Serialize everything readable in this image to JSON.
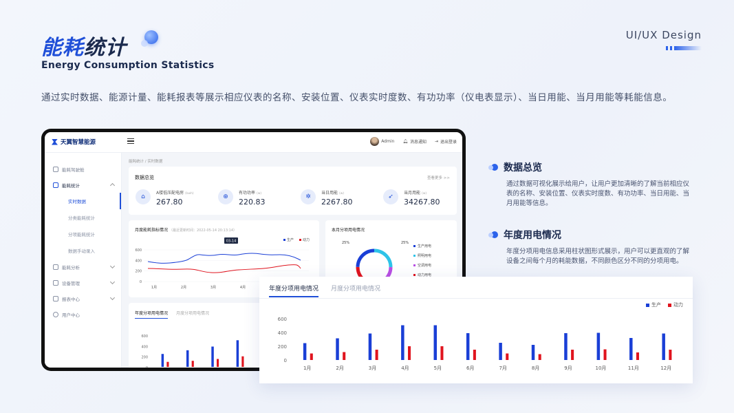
{
  "header": {
    "title_cn_blue": "能耗",
    "title_cn_rest": "统计",
    "title_en": "Energy Consumption Statistics",
    "brand_tag": "UI/UX Design",
    "intro": "通过实时数据、能源计量、能耗报表等展示相应仪表的名称、安装位置、仪表实时度数、有功功率（仪电表显示）、当日用能、当月用能等耗能信息。"
  },
  "app": {
    "logo": "天翼智慧能源",
    "user": "Admin",
    "notify": "消息通知",
    "logout": "退出登录",
    "breadcrumb": "能耗统计 / 实时数据",
    "sidebar": [
      {
        "label": "能耗驾驶舱",
        "icon": "home-icon"
      },
      {
        "label": "能耗统计",
        "icon": "stats-icon",
        "open": true
      },
      {
        "label": "能耗分析",
        "icon": "analysis-icon"
      },
      {
        "label": "设备管理",
        "icon": "device-icon"
      },
      {
        "label": "报表中心",
        "icon": "report-icon"
      },
      {
        "label": "用户中心",
        "icon": "user-icon"
      }
    ],
    "submenu": [
      "实时数据",
      "分类能耗统计",
      "分项能耗统计",
      "数据手动录入"
    ],
    "overview": {
      "title": "数据总览",
      "more": "查看更多 >>",
      "items": [
        {
          "label": "A楼低压配电房",
          "unit": "(kwh)",
          "value": "267.80",
          "icon": "building-icon"
        },
        {
          "label": "有功功率",
          "unit": "(w)",
          "value": "220.83",
          "icon": "power-icon"
        },
        {
          "label": "当日用能",
          "unit": "(w)",
          "value": "2267.80",
          "icon": "daily-icon"
        },
        {
          "label": "当月用能",
          "unit": "(w)",
          "value": "34267.80",
          "icon": "rocket-icon"
        }
      ]
    },
    "line_card": {
      "title": "月度能耗指标情况",
      "sub": "（最近更新时间：2022-05-14 20:13:14）",
      "tooltip": "03-14"
    },
    "pie_card": {
      "title": "本月分项用电情况",
      "pct_left": "25%",
      "pct_right": "25%",
      "legend": [
        "生产用电",
        "照明用电",
        "空调用电",
        "动力用电"
      ]
    },
    "bar_tabs": [
      "年度分项用电情况",
      "月度分项用电情况"
    ]
  },
  "features": [
    {
      "title": "数据总览",
      "text": "通过数据可视化展示给用户，让用户更加清晰的了解当前相应仪表的名称、安装位置、仪表实时度数、有功功率、当日用能、当月用能等信息。"
    },
    {
      "title": "年度用电情况",
      "text": "年度分项用电信息采用柱状图形式展示，用户可以更直观的了解设备之间每个月的耗能数据，不同颜色区分不同的分项用电。"
    }
  ],
  "popup": {
    "tabs": [
      "年度分项用电情况",
      "月度分项用电情况"
    ]
  },
  "colors": {
    "accent": "#1f4fd8",
    "production": "#1a3fd6",
    "power": "#e0141e",
    "cyan": "#2ec3e8",
    "purple": "#b94fe3"
  },
  "chart_data": [
    {
      "type": "bar",
      "title": "年度分项用电情况",
      "categories": [
        "1月",
        "2月",
        "3月",
        "4月",
        "5月",
        "6月",
        "7月",
        "8月",
        "9月",
        "10月",
        "11月",
        "12月"
      ],
      "ylim": [
        0,
        600
      ],
      "yticks": [
        0,
        200,
        400,
        600
      ],
      "series": [
        {
          "name": "生产",
          "values": [
            245,
            315,
            385,
            505,
            505,
            390,
            250,
            220,
            390,
            395,
            320,
            385
          ],
          "color": "#1a3fd6"
        },
        {
          "name": "动力",
          "values": [
            95,
            115,
            150,
            200,
            200,
            150,
            95,
            85,
            150,
            155,
            110,
            150
          ],
          "color": "#e0141e"
        }
      ]
    },
    {
      "type": "line",
      "title": "月度能耗指标情况",
      "categories": [
        "1月",
        "2月",
        "3月",
        "4月"
      ],
      "ylim": [
        0,
        600
      ],
      "yticks": [
        0,
        200,
        400,
        600
      ],
      "series": [
        {
          "name": "生产",
          "color": "#1a3fd6"
        },
        {
          "name": "动力",
          "color": "#e0141e"
        }
      ]
    }
  ]
}
